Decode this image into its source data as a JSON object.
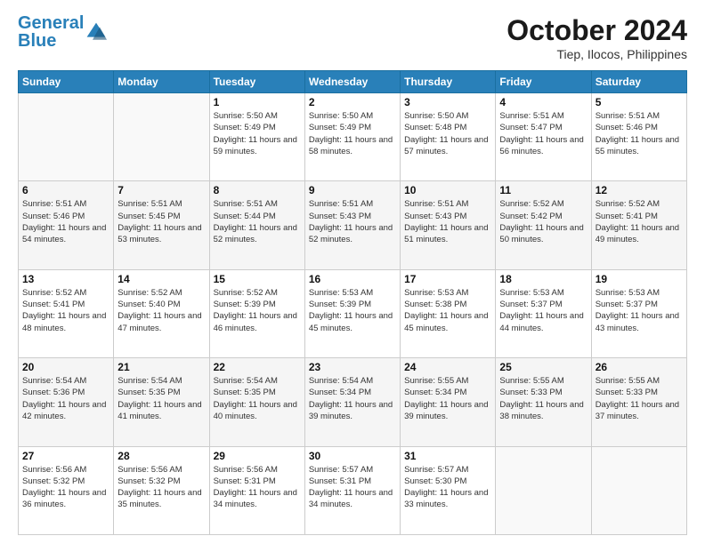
{
  "logo": {
    "text1": "General",
    "text2": "Blue"
  },
  "title": "October 2024",
  "subtitle": "Tiep, Ilocos, Philippines",
  "headers": [
    "Sunday",
    "Monday",
    "Tuesday",
    "Wednesday",
    "Thursday",
    "Friday",
    "Saturday"
  ],
  "weeks": [
    [
      {
        "day": "",
        "info": ""
      },
      {
        "day": "",
        "info": ""
      },
      {
        "day": "1",
        "info": "Sunrise: 5:50 AM\nSunset: 5:49 PM\nDaylight: 11 hours and 59 minutes."
      },
      {
        "day": "2",
        "info": "Sunrise: 5:50 AM\nSunset: 5:49 PM\nDaylight: 11 hours and 58 minutes."
      },
      {
        "day": "3",
        "info": "Sunrise: 5:50 AM\nSunset: 5:48 PM\nDaylight: 11 hours and 57 minutes."
      },
      {
        "day": "4",
        "info": "Sunrise: 5:51 AM\nSunset: 5:47 PM\nDaylight: 11 hours and 56 minutes."
      },
      {
        "day": "5",
        "info": "Sunrise: 5:51 AM\nSunset: 5:46 PM\nDaylight: 11 hours and 55 minutes."
      }
    ],
    [
      {
        "day": "6",
        "info": "Sunrise: 5:51 AM\nSunset: 5:46 PM\nDaylight: 11 hours and 54 minutes."
      },
      {
        "day": "7",
        "info": "Sunrise: 5:51 AM\nSunset: 5:45 PM\nDaylight: 11 hours and 53 minutes."
      },
      {
        "day": "8",
        "info": "Sunrise: 5:51 AM\nSunset: 5:44 PM\nDaylight: 11 hours and 52 minutes."
      },
      {
        "day": "9",
        "info": "Sunrise: 5:51 AM\nSunset: 5:43 PM\nDaylight: 11 hours and 52 minutes."
      },
      {
        "day": "10",
        "info": "Sunrise: 5:51 AM\nSunset: 5:43 PM\nDaylight: 11 hours and 51 minutes."
      },
      {
        "day": "11",
        "info": "Sunrise: 5:52 AM\nSunset: 5:42 PM\nDaylight: 11 hours and 50 minutes."
      },
      {
        "day": "12",
        "info": "Sunrise: 5:52 AM\nSunset: 5:41 PM\nDaylight: 11 hours and 49 minutes."
      }
    ],
    [
      {
        "day": "13",
        "info": "Sunrise: 5:52 AM\nSunset: 5:41 PM\nDaylight: 11 hours and 48 minutes."
      },
      {
        "day": "14",
        "info": "Sunrise: 5:52 AM\nSunset: 5:40 PM\nDaylight: 11 hours and 47 minutes."
      },
      {
        "day": "15",
        "info": "Sunrise: 5:52 AM\nSunset: 5:39 PM\nDaylight: 11 hours and 46 minutes."
      },
      {
        "day": "16",
        "info": "Sunrise: 5:53 AM\nSunset: 5:39 PM\nDaylight: 11 hours and 45 minutes."
      },
      {
        "day": "17",
        "info": "Sunrise: 5:53 AM\nSunset: 5:38 PM\nDaylight: 11 hours and 45 minutes."
      },
      {
        "day": "18",
        "info": "Sunrise: 5:53 AM\nSunset: 5:37 PM\nDaylight: 11 hours and 44 minutes."
      },
      {
        "day": "19",
        "info": "Sunrise: 5:53 AM\nSunset: 5:37 PM\nDaylight: 11 hours and 43 minutes."
      }
    ],
    [
      {
        "day": "20",
        "info": "Sunrise: 5:54 AM\nSunset: 5:36 PM\nDaylight: 11 hours and 42 minutes."
      },
      {
        "day": "21",
        "info": "Sunrise: 5:54 AM\nSunset: 5:35 PM\nDaylight: 11 hours and 41 minutes."
      },
      {
        "day": "22",
        "info": "Sunrise: 5:54 AM\nSunset: 5:35 PM\nDaylight: 11 hours and 40 minutes."
      },
      {
        "day": "23",
        "info": "Sunrise: 5:54 AM\nSunset: 5:34 PM\nDaylight: 11 hours and 39 minutes."
      },
      {
        "day": "24",
        "info": "Sunrise: 5:55 AM\nSunset: 5:34 PM\nDaylight: 11 hours and 39 minutes."
      },
      {
        "day": "25",
        "info": "Sunrise: 5:55 AM\nSunset: 5:33 PM\nDaylight: 11 hours and 38 minutes."
      },
      {
        "day": "26",
        "info": "Sunrise: 5:55 AM\nSunset: 5:33 PM\nDaylight: 11 hours and 37 minutes."
      }
    ],
    [
      {
        "day": "27",
        "info": "Sunrise: 5:56 AM\nSunset: 5:32 PM\nDaylight: 11 hours and 36 minutes."
      },
      {
        "day": "28",
        "info": "Sunrise: 5:56 AM\nSunset: 5:32 PM\nDaylight: 11 hours and 35 minutes."
      },
      {
        "day": "29",
        "info": "Sunrise: 5:56 AM\nSunset: 5:31 PM\nDaylight: 11 hours and 34 minutes."
      },
      {
        "day": "30",
        "info": "Sunrise: 5:57 AM\nSunset: 5:31 PM\nDaylight: 11 hours and 34 minutes."
      },
      {
        "day": "31",
        "info": "Sunrise: 5:57 AM\nSunset: 5:30 PM\nDaylight: 11 hours and 33 minutes."
      },
      {
        "day": "",
        "info": ""
      },
      {
        "day": "",
        "info": ""
      }
    ]
  ]
}
